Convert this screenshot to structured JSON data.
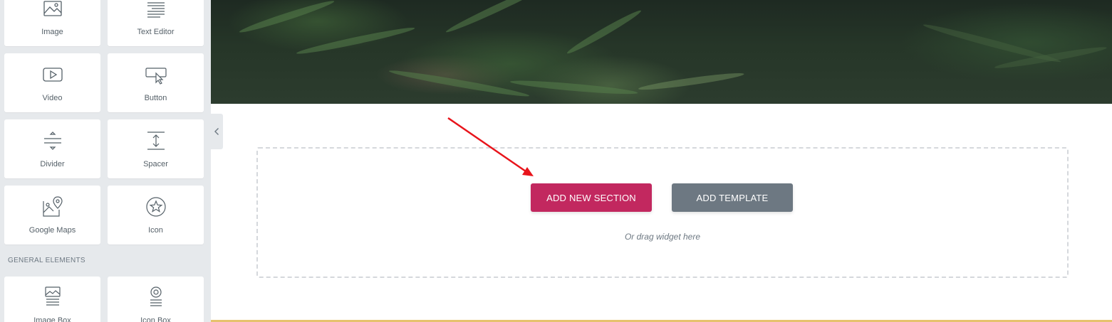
{
  "sidebar": {
    "widgets_basic": [
      {
        "label": "Image",
        "icon": "image-icon"
      },
      {
        "label": "Text Editor",
        "icon": "text-editor-icon"
      },
      {
        "label": "Video",
        "icon": "video-icon"
      },
      {
        "label": "Button",
        "icon": "button-icon"
      },
      {
        "label": "Divider",
        "icon": "divider-icon"
      },
      {
        "label": "Spacer",
        "icon": "spacer-icon"
      },
      {
        "label": "Google Maps",
        "icon": "google-maps-icon"
      },
      {
        "label": "Icon",
        "icon": "star-icon"
      }
    ],
    "general_section_title": "GENERAL ELEMENTS",
    "widgets_general": [
      {
        "label": "Image Box",
        "icon": "image-box-icon"
      },
      {
        "label": "Icon Box",
        "icon": "icon-box-icon"
      }
    ]
  },
  "canvas": {
    "add_section_label": "ADD NEW SECTION",
    "add_template_label": "ADD TEMPLATE",
    "drag_hint": "Or drag widget here"
  },
  "colors": {
    "accent": "#c2285f",
    "secondary": "#6d7882",
    "sidebar_bg": "#e6e9ec",
    "annotation_arrow": "#e8141b",
    "footer_bar": "#e6c26e"
  }
}
